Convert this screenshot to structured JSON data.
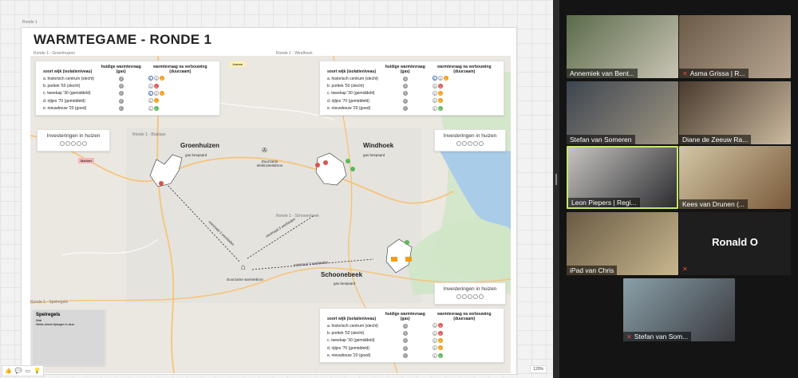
{
  "board": {
    "frame_label": "Ronde 1",
    "title": "WARMTEGAME - RONDE 1",
    "sub_labels": {
      "groenhuizen": "Ronde 1 - Groenhuizen",
      "windhoek": "Ronde 1 - Windhoek",
      "brakkan": "Ronde 1 - Brakkan",
      "schoonebeek": "Ronde 1 - Schoonebeek",
      "spelregels": "Ronde 1 - Spelregels"
    },
    "sticky_joanne": "Joanne",
    "sticky_marloes": "Marloes",
    "table": {
      "col_type": "soort wijk (isolatieniveau)",
      "col_current": "huidige warmtevraag (gas)",
      "col_after": "warmtevraag na verbouwing (duurzaam)",
      "rows": [
        {
          "label": "a.  historisch centrum (slecht)",
          "current": "3"
        },
        {
          "label": "b.  portiek '50 (slecht)",
          "current": "3"
        },
        {
          "label": "c.  tweekap '30 (gemiddeld)",
          "current": "2"
        },
        {
          "label": "d.  rijtjes '70 (gemiddeld)",
          "current": "2"
        },
        {
          "label": "e.  nieuwbouw '20 (goed)",
          "current": "1"
        }
      ]
    },
    "invest_label": "Investeringen in huizen",
    "places": {
      "groenhuizen": "Groenhuizen",
      "windhoek": "Windhoek",
      "schoonebeek": "Schoonebeek"
    },
    "gas_bespaard": "gas bespaard",
    "elec_source": "Duurzame elektriciteitsbron",
    "heat_source": "Duurzame warmtebron",
    "route_labels": [
      "minimaal 1 eenheden",
      "minimaal 3 eenheden",
      "minimaal 3 eenheden"
    ],
    "rules": {
      "title": "Spelregels",
      "subtitle": "Wat",
      "text": "Welke cirkels bijdragen in deze"
    },
    "zoom": "120%"
  },
  "participants": [
    {
      "name": "Annemiek van Bent...",
      "muted": false
    },
    {
      "name": "Asma Grissa | R...",
      "muted": true
    },
    {
      "name": "Stefan van Someren",
      "muted": false
    },
    {
      "name": "Diane de Zeeuw Ra...",
      "muted": false
    },
    {
      "name": "Leon Piepers | Regi...",
      "muted": false
    },
    {
      "name": "Kees van Drunen (...",
      "muted": false
    },
    {
      "name": "iPad van Chris",
      "muted": false
    },
    {
      "name": "Ronald O",
      "muted": true
    },
    {
      "name": "Stefan van Som...",
      "muted": true
    }
  ],
  "colors": {
    "accent_active": "#c7e86a",
    "muted": "#e74c3c",
    "road": "#f7c37a",
    "water": "#a9cce8"
  }
}
